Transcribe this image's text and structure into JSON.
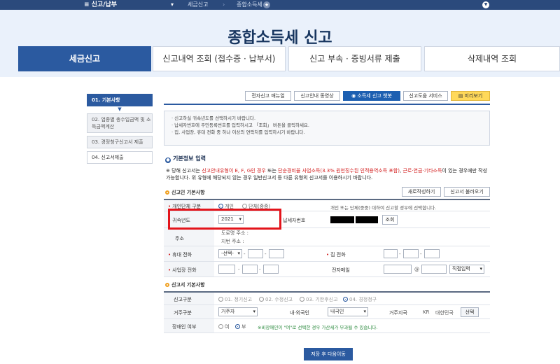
{
  "topnav": {
    "menu": "≡ 신고/납부",
    "crumbs": [
      "세금신고",
      "종합소득세"
    ]
  },
  "hero": {
    "title": "종합소득세 신고"
  },
  "tabs": [
    {
      "label": "세금신고",
      "active": true
    },
    {
      "label": "신고내역 조회 (접수증 · 납부서)"
    },
    {
      "label": "신고 부속 · 증빙서류 제출"
    },
    {
      "label": "삭제내역 조회"
    }
  ],
  "steps": [
    {
      "label": "01. 기본사항",
      "active": true
    },
    {
      "label": "02. 업종별 총수입금액 및 소득금액계산"
    },
    {
      "label": "03. 경정청구신고서 제출"
    },
    {
      "label": "04. 신고서제출"
    }
  ],
  "buttons": {
    "manual": "전자신고 매뉴얼",
    "video": "신고안내 동영상",
    "chatbot": "소득세 신고 챗봇",
    "help": "신고도움 서비스",
    "preview": "미리보기"
  },
  "notice": [
    "· 신고하실 귀속년도를 선택하시기 바랍니다.",
    "· 납세자번호에 주민등록번호를 입력하시고 「조회」 버튼을 클릭하세요.",
    "· 집, 사업장, 휴대 전화 중 하나 이상의 연락처를 입력하시기 바랍니다."
  ],
  "section1": {
    "title": "기본정보 입력"
  },
  "warning": {
    "p1": "※ 당해 신고서는 ",
    "red1": "신고안내유형이 E, F, G인 경우",
    "p2": " 또는 ",
    "red2": "단순경비율 사업소득(3.3% 원천징수된 인적용역소득 포함)",
    "p3": ", ",
    "red3": "근로·연금·기타소득",
    "p4": "이 있는 경우에만 작성 가능합니다. 위 유형에 해당되지 않는 경우 일반신고서 등 다른 유형의 신고서를 이용하시기 바랍니다."
  },
  "basic": {
    "title": "신고인 기본사항",
    "reset": "새로작성하기",
    "load": "신고서 불러오기",
    "type_label": "개인단체 구분",
    "type_opt1": "개인",
    "type_opt2": "단체(중중)",
    "type_hint": "개인 또는 단체(중중) 대하여 신고할 경우에 선택합니다.",
    "year_label": "귀속년도",
    "year_value": "2021",
    "taxno_label": "납세자번호",
    "lookup": "조회",
    "addr_label": "주소",
    "addr_road": "도로명 주소 :",
    "addr_lot": "지번 주소 :",
    "mobile_label": "휴대 전화",
    "mobile_select": "-선택-",
    "home_label": "집 전화",
    "biz_label": "사업장 전화",
    "email_label": "전자메일",
    "email_at": "@",
    "email_domain": "직접입력"
  },
  "report": {
    "title": "신고서 기본사항",
    "kind_label": "신고구분",
    "kind_opts": [
      "01. 정기신고",
      "02. 수정신고",
      "03. 기한후신고",
      "04. 경정청구"
    ],
    "res_label": "거주구분",
    "res_value": "거주자",
    "nat_label": "내·외국인",
    "nat_value": "내국인",
    "region_label": "거주지국",
    "region_code": "KR",
    "region_name": "대한민국",
    "region_btn": "선택",
    "dis_label": "장애인 여부",
    "dis_yes": "여",
    "dis_no": "부",
    "dis_note": "※비장애인이 \"여\"로 선택한 경우 가산세가 부과될 수 있습니다."
  },
  "save": "저장 후 다음이동"
}
